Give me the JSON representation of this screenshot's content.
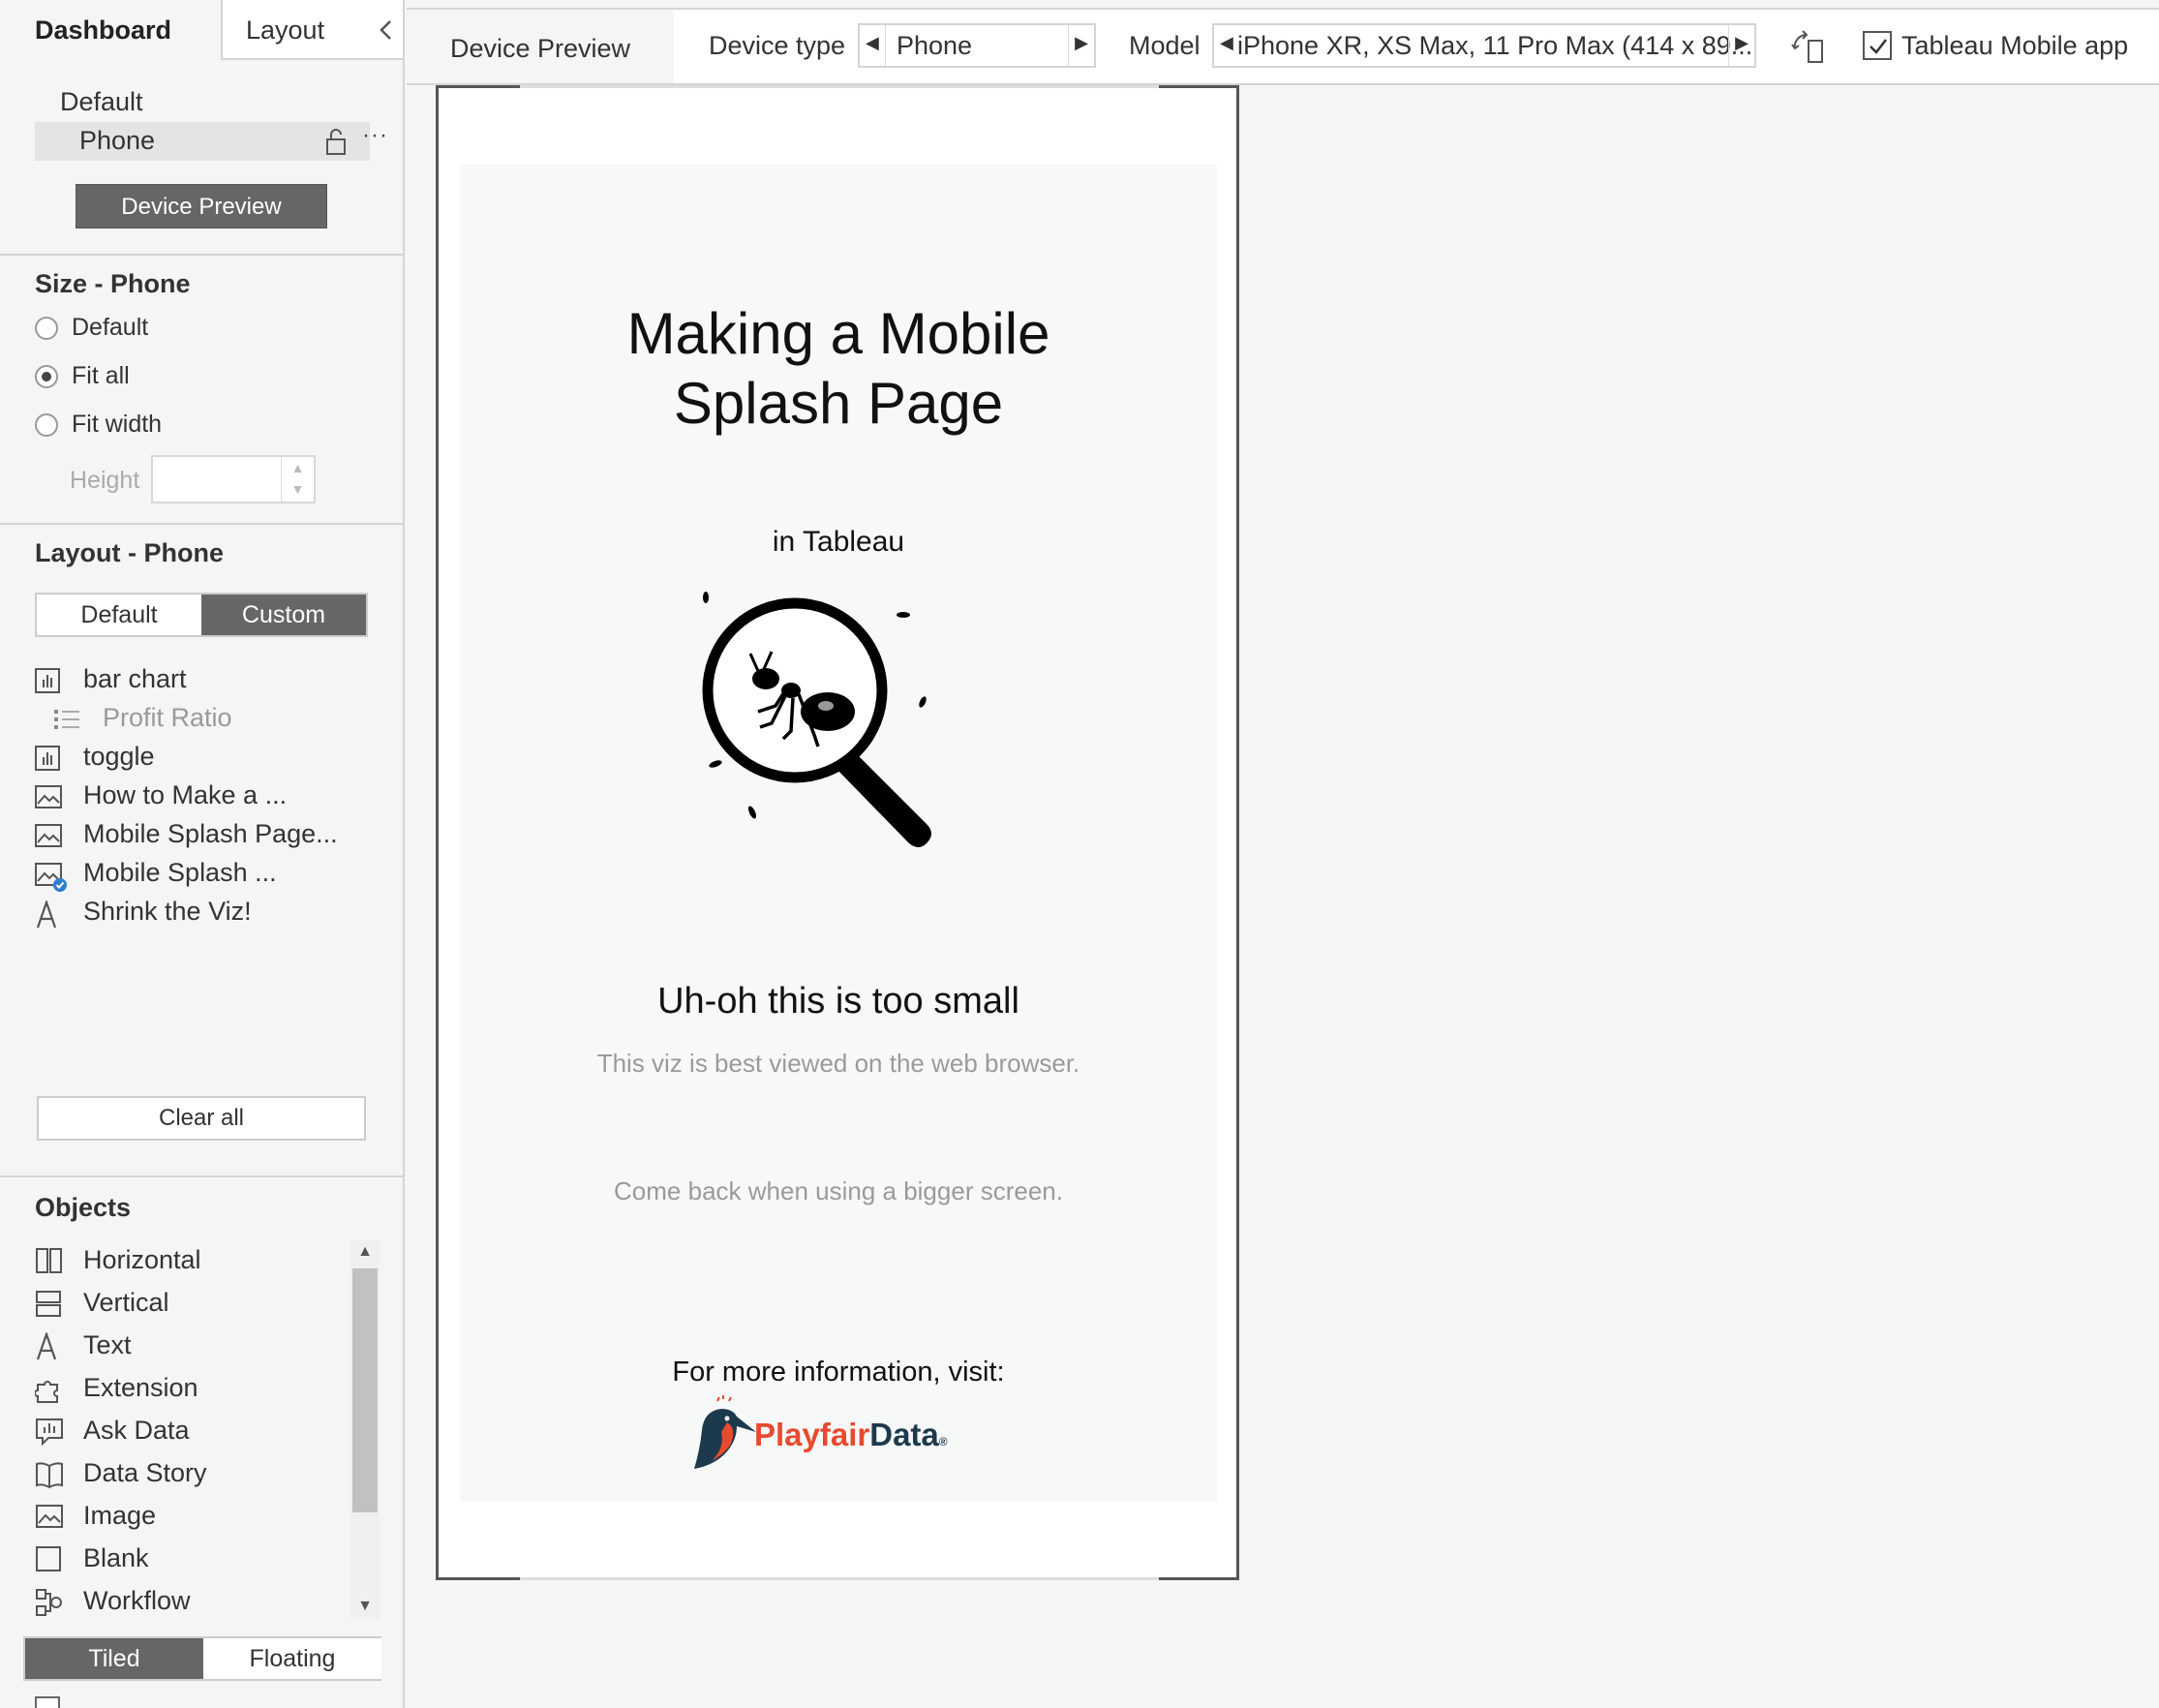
{
  "sidebar": {
    "tabs": {
      "dashboard": "Dashboard",
      "layout": "Layout"
    },
    "device_layouts": {
      "default": "Default",
      "phone": "Phone",
      "more": "···"
    },
    "device_preview_button": "Device Preview",
    "size": {
      "title": "Size - Phone",
      "options": [
        {
          "label": "Default",
          "selected": false
        },
        {
          "label": "Fit all",
          "selected": true
        },
        {
          "label": "Fit width",
          "selected": false
        }
      ],
      "height_label": "Height",
      "height_value": ""
    },
    "layout": {
      "title": "Layout - Phone",
      "mode_default": "Default",
      "mode_custom": "Custom",
      "selected_mode": "Custom",
      "items": [
        {
          "label": "bar chart",
          "icon": "bar-chart-icon"
        },
        {
          "label": "Profit Ratio",
          "icon": "legend-icon",
          "sub": true
        },
        {
          "label": "toggle",
          "icon": "bar-chart-icon"
        },
        {
          "label": "How to Make a ...",
          "icon": "image-icon"
        },
        {
          "label": "Mobile Splash Page...",
          "icon": "image-icon"
        },
        {
          "label": "Mobile Splash ...",
          "icon": "image-check-icon"
        },
        {
          "label": "Shrink the Viz!",
          "icon": "text-icon"
        }
      ],
      "clear_all": "Clear all"
    },
    "objects": {
      "title": "Objects",
      "items": [
        {
          "label": "Horizontal",
          "icon": "horizontal-icon"
        },
        {
          "label": "Vertical",
          "icon": "vertical-icon"
        },
        {
          "label": "Text",
          "icon": "text-icon"
        },
        {
          "label": "Extension",
          "icon": "puzzle-icon"
        },
        {
          "label": "Ask Data",
          "icon": "ask-data-icon"
        },
        {
          "label": "Data Story",
          "icon": "book-icon"
        },
        {
          "label": "Image",
          "icon": "image-icon"
        },
        {
          "label": "Blank",
          "icon": "blank-icon"
        },
        {
          "label": "Workflow",
          "icon": "workflow-icon"
        }
      ],
      "tiled": "Tiled",
      "floating": "Floating",
      "selected": "Tiled"
    }
  },
  "toolbar": {
    "title": "Device Preview",
    "device_type_label": "Device type",
    "device_type_value": "Phone",
    "model_label": "Model",
    "model_value": "iPhone XR, XS Max, 11 Pro Max (414 x 89...",
    "tableau_mobile_label": "Tableau Mobile app",
    "tableau_mobile_checked": true
  },
  "splash": {
    "title_line1": "Making a Mobile",
    "title_line2": "Splash Page",
    "subtitle": "in Tableau",
    "heading": "Uh-oh this is too small",
    "line1": "This viz is best viewed on the web browser.",
    "line2": "Come back when using a bigger screen.",
    "info": "For more information, visit:",
    "logo_part1": "Playfair",
    "logo_part2": "Data",
    "logo_reg": "®"
  },
  "colors": {
    "accent_dark": "#666666",
    "logo_orange": "#e84a2d",
    "logo_navy": "#1d3a4d"
  }
}
